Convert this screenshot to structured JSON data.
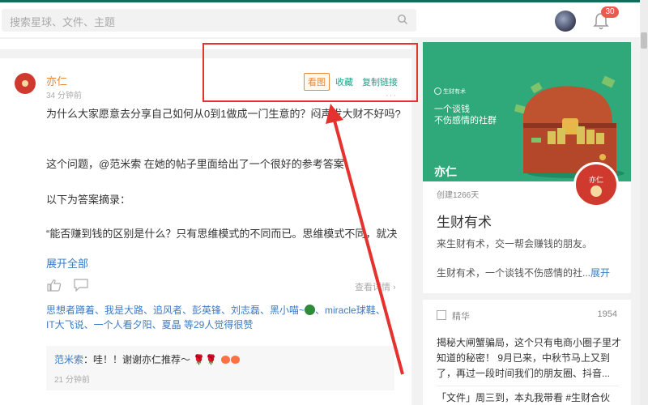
{
  "search": {
    "placeholder": "搜索星球、文件、主题"
  },
  "notifications": {
    "count": "30"
  },
  "post": {
    "author": "亦仁",
    "time": "34 分钟前",
    "actions": {
      "view_image": "看图",
      "favorite": "收藏",
      "copy_link": "复制链接"
    },
    "more": "···",
    "paragraphs": [
      "为什么大家愿意去分享自己如何从0到1做成一门生意的？闷声发大财不好吗?",
      "这个问题，@范米索  在她的帖子里面给出了一个很好的参考答案",
      "以下为答案摘录：",
      "“能否赚到钱的区别是什么？只有思维模式的不同而已。思维模式不同，就决"
    ],
    "expand": "展开全部",
    "view_detail": "查看详情 ›",
    "likers_line1": "思想者蹲着、我是大路、追风者、彭英锋、刘志磊、黑小喵~",
    "likers_line1b": "、miracle球鞋、",
    "likers_line2": "IT大飞说、一个人看夕阳、夏晶 等29人觉得很赞",
    "reply": {
      "who": "范米索",
      "text": "：哇！！谢谢亦仁推荐～",
      "time": "21 分钟前"
    }
  },
  "group": {
    "banner_logo": "生财有术",
    "banner_slogan1": "一个谈钱",
    "banner_slogan2": "不伤感情的社群",
    "banner_owner": "亦仁",
    "avatar_label": "亦仁",
    "created": "创建1266天",
    "title": "生财有术",
    "desc1": "来生财有术，交一帮会赚钱的朋友。",
    "desc2": "生财有术，一个谈钱不伤感情的社...",
    "desc_more": "展开",
    "colors": {
      "banner": "#2fa87a",
      "accent": "#1ca38a",
      "owner": "#d03a2e"
    }
  },
  "highlights": {
    "label": "精华",
    "count": "1954",
    "item1": "揭秘大闸蟹骗局，这个只有电商小圈子里才知道的秘密！ 9月已来，中秋节马上又到了，再过一段时间我们的朋友圈、抖音...",
    "item2": "「文件」周三到，本丸我带看 #生财合伙"
  }
}
